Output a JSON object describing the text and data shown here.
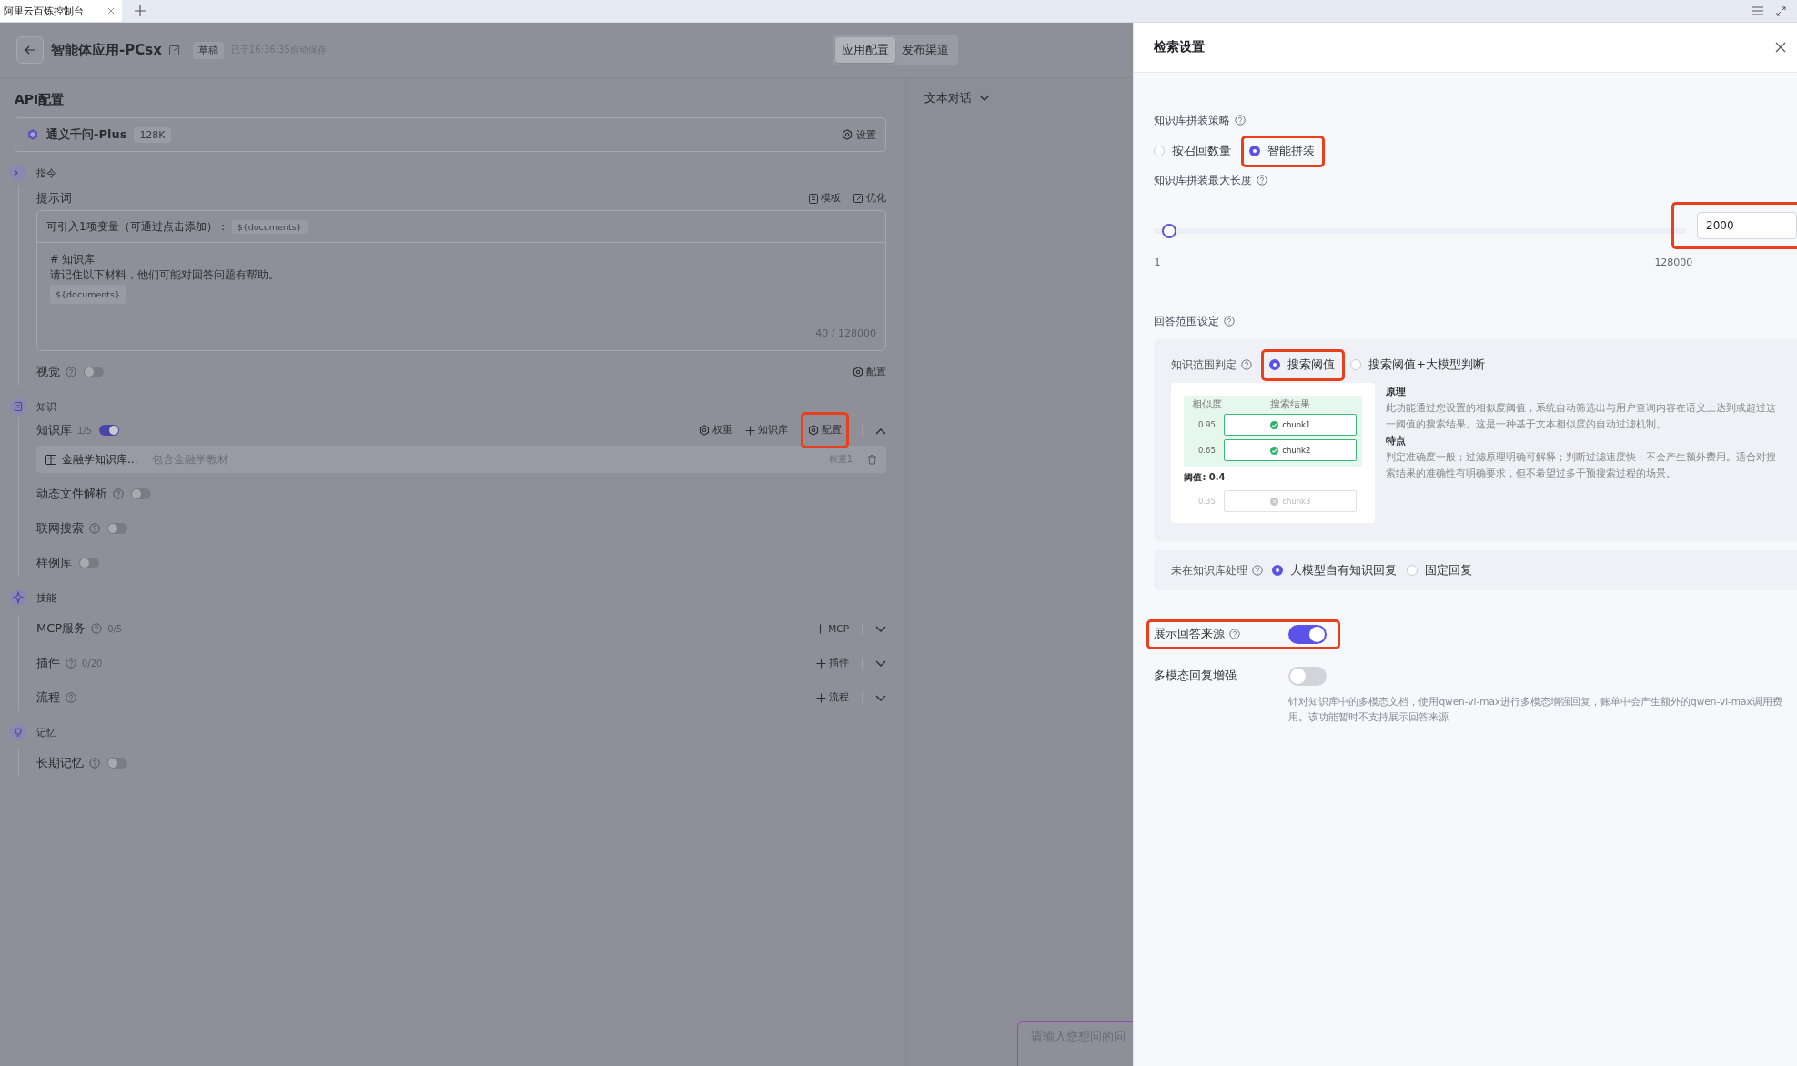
{
  "browser": {
    "tab_title": "阿里云百炼控制台"
  },
  "header": {
    "title": "智能体应用-PCsx",
    "status_tag": "草稿",
    "autosave": "已于16:36:35自动保存",
    "tabs": [
      {
        "label": "应用配置",
        "selected": true
      },
      {
        "label": "发布渠道",
        "selected": false
      }
    ]
  },
  "config": {
    "heading": "API配置",
    "model": {
      "name": "通义千问-Plus",
      "context": "128K",
      "settings": "设置"
    },
    "sections": [
      {
        "title": "指令",
        "kind": "instruction",
        "items": [
          {
            "kind": "prompt",
            "label": "提示词",
            "actions": [
              "模板",
              "优化"
            ],
            "variable_hint": "可引入1项变量（可通过点击添加）：",
            "variable_tag": "${documents}",
            "lines": [
              "# 知识库",
              "请记住以下材料，他们可能对回答问题有帮助。"
            ],
            "body_tag": "${documents}",
            "counter": "40 / 128000"
          },
          {
            "kind": "toggle",
            "label": "视觉",
            "help": true,
            "on": false,
            "action": "配置"
          }
        ]
      },
      {
        "title": "知识",
        "kind": "knowledge",
        "items": [
          {
            "kind": "knowledge",
            "label": "知识库",
            "count": "1/5",
            "on": true,
            "expanded": true,
            "actions": [
              {
                "kind": "settings",
                "label": "权重",
                "highlighted": false
              },
              {
                "kind": "add",
                "label": "知识库",
                "highlighted": false
              },
              {
                "kind": "settings",
                "label": "配置",
                "highlighted": true
              }
            ],
            "entries": [
              {
                "name": "金融学知识库...",
                "description": "包含金融学教材",
                "weight": "权重1"
              }
            ]
          },
          {
            "kind": "toggle",
            "label": "动态文件解析",
            "help": true,
            "on": false
          },
          {
            "kind": "toggle",
            "label": "联网搜索",
            "help": true,
            "on": false
          },
          {
            "kind": "toggle",
            "label": "样例库",
            "help": false,
            "on": false
          }
        ]
      },
      {
        "title": "技能",
        "kind": "skills",
        "items": [
          {
            "kind": "expandable",
            "label": "MCP服务",
            "help": true,
            "count": "0/5",
            "add": "MCP",
            "expanded": false
          },
          {
            "kind": "expandable",
            "label": "插件",
            "help": true,
            "count": "0/20",
            "add": "插件",
            "expanded": false
          },
          {
            "kind": "expandable",
            "label": "流程",
            "help": true,
            "add": "流程",
            "expanded": false
          }
        ]
      },
      {
        "title": "记忆",
        "kind": "memory",
        "items": [
          {
            "kind": "toggle",
            "label": "长期记忆",
            "help": true,
            "on": false
          }
        ]
      }
    ]
  },
  "chat": {
    "mode": "文本对话",
    "placeholder": "请输入您想问的问"
  },
  "drawer": {
    "title": "检索设置",
    "assembly": {
      "label": "知识库拼装策略",
      "options": [
        {
          "label": "按召回数量",
          "selected": false,
          "highlighted": false
        },
        {
          "label": "智能拼装",
          "selected": true,
          "highlighted": true
        }
      ]
    },
    "max_length": {
      "label": "知识库拼装最大长度",
      "level": 0.016,
      "min": "1",
      "max": "128000",
      "value": "2000",
      "highlighted": true
    },
    "scope": {
      "label": "回答范围设定",
      "judge": {
        "label": "知识范围判定",
        "options": [
          {
            "label": "搜索阈值",
            "selected": true,
            "highlighted": true
          },
          {
            "label": "搜索阈值+大模型判断",
            "selected": false,
            "highlighted": false
          }
        ]
      },
      "diagram": {
        "headers": [
          "相似度",
          "搜索结果"
        ],
        "threshold": "阈值: 0.4",
        "rows": [
          {
            "score": "0.95",
            "chunk": "chunk1",
            "passed": true
          },
          {
            "score": "0.65",
            "chunk": "chunk2",
            "passed": true
          },
          {
            "score": "0.35",
            "chunk": "chunk3",
            "passed": false
          }
        ]
      },
      "explanation": [
        {
          "heading": "原理",
          "text": "此功能通过您设置的相似度阈值，系统自动筛选出与用户查询内容在语义上达到或超过这一阈值的搜索结果。这是一种基于文本相似度的自动过滤机制。"
        },
        {
          "heading": "特点",
          "text": "判定准确度一般；过滤原理明确可解释；判断过滤速度快；不会产生额外费用。适合对搜索结果的准确性有明确要求，但不希望过多干预搜索过程的场景。"
        }
      ],
      "fallback": {
        "label": "未在知识库处理",
        "options": [
          {
            "label": "大模型自有知识回复",
            "selected": true,
            "highlighted": false
          },
          {
            "label": "固定回复",
            "selected": false,
            "highlighted": false
          }
        ]
      }
    },
    "toggles": [
      {
        "label": "展示回答来源",
        "help": true,
        "on": true,
        "highlighted": true
      },
      {
        "label": "多模态回复增强",
        "help": false,
        "on": false,
        "highlighted": false,
        "description": "针对知识库中的多模态文档，使用qwen-vl-max进行多模态增强回复，账单中会产生额外的qwen-vl-max调用费用。该功能暂时不支持展示回答来源"
      }
    ]
  }
}
